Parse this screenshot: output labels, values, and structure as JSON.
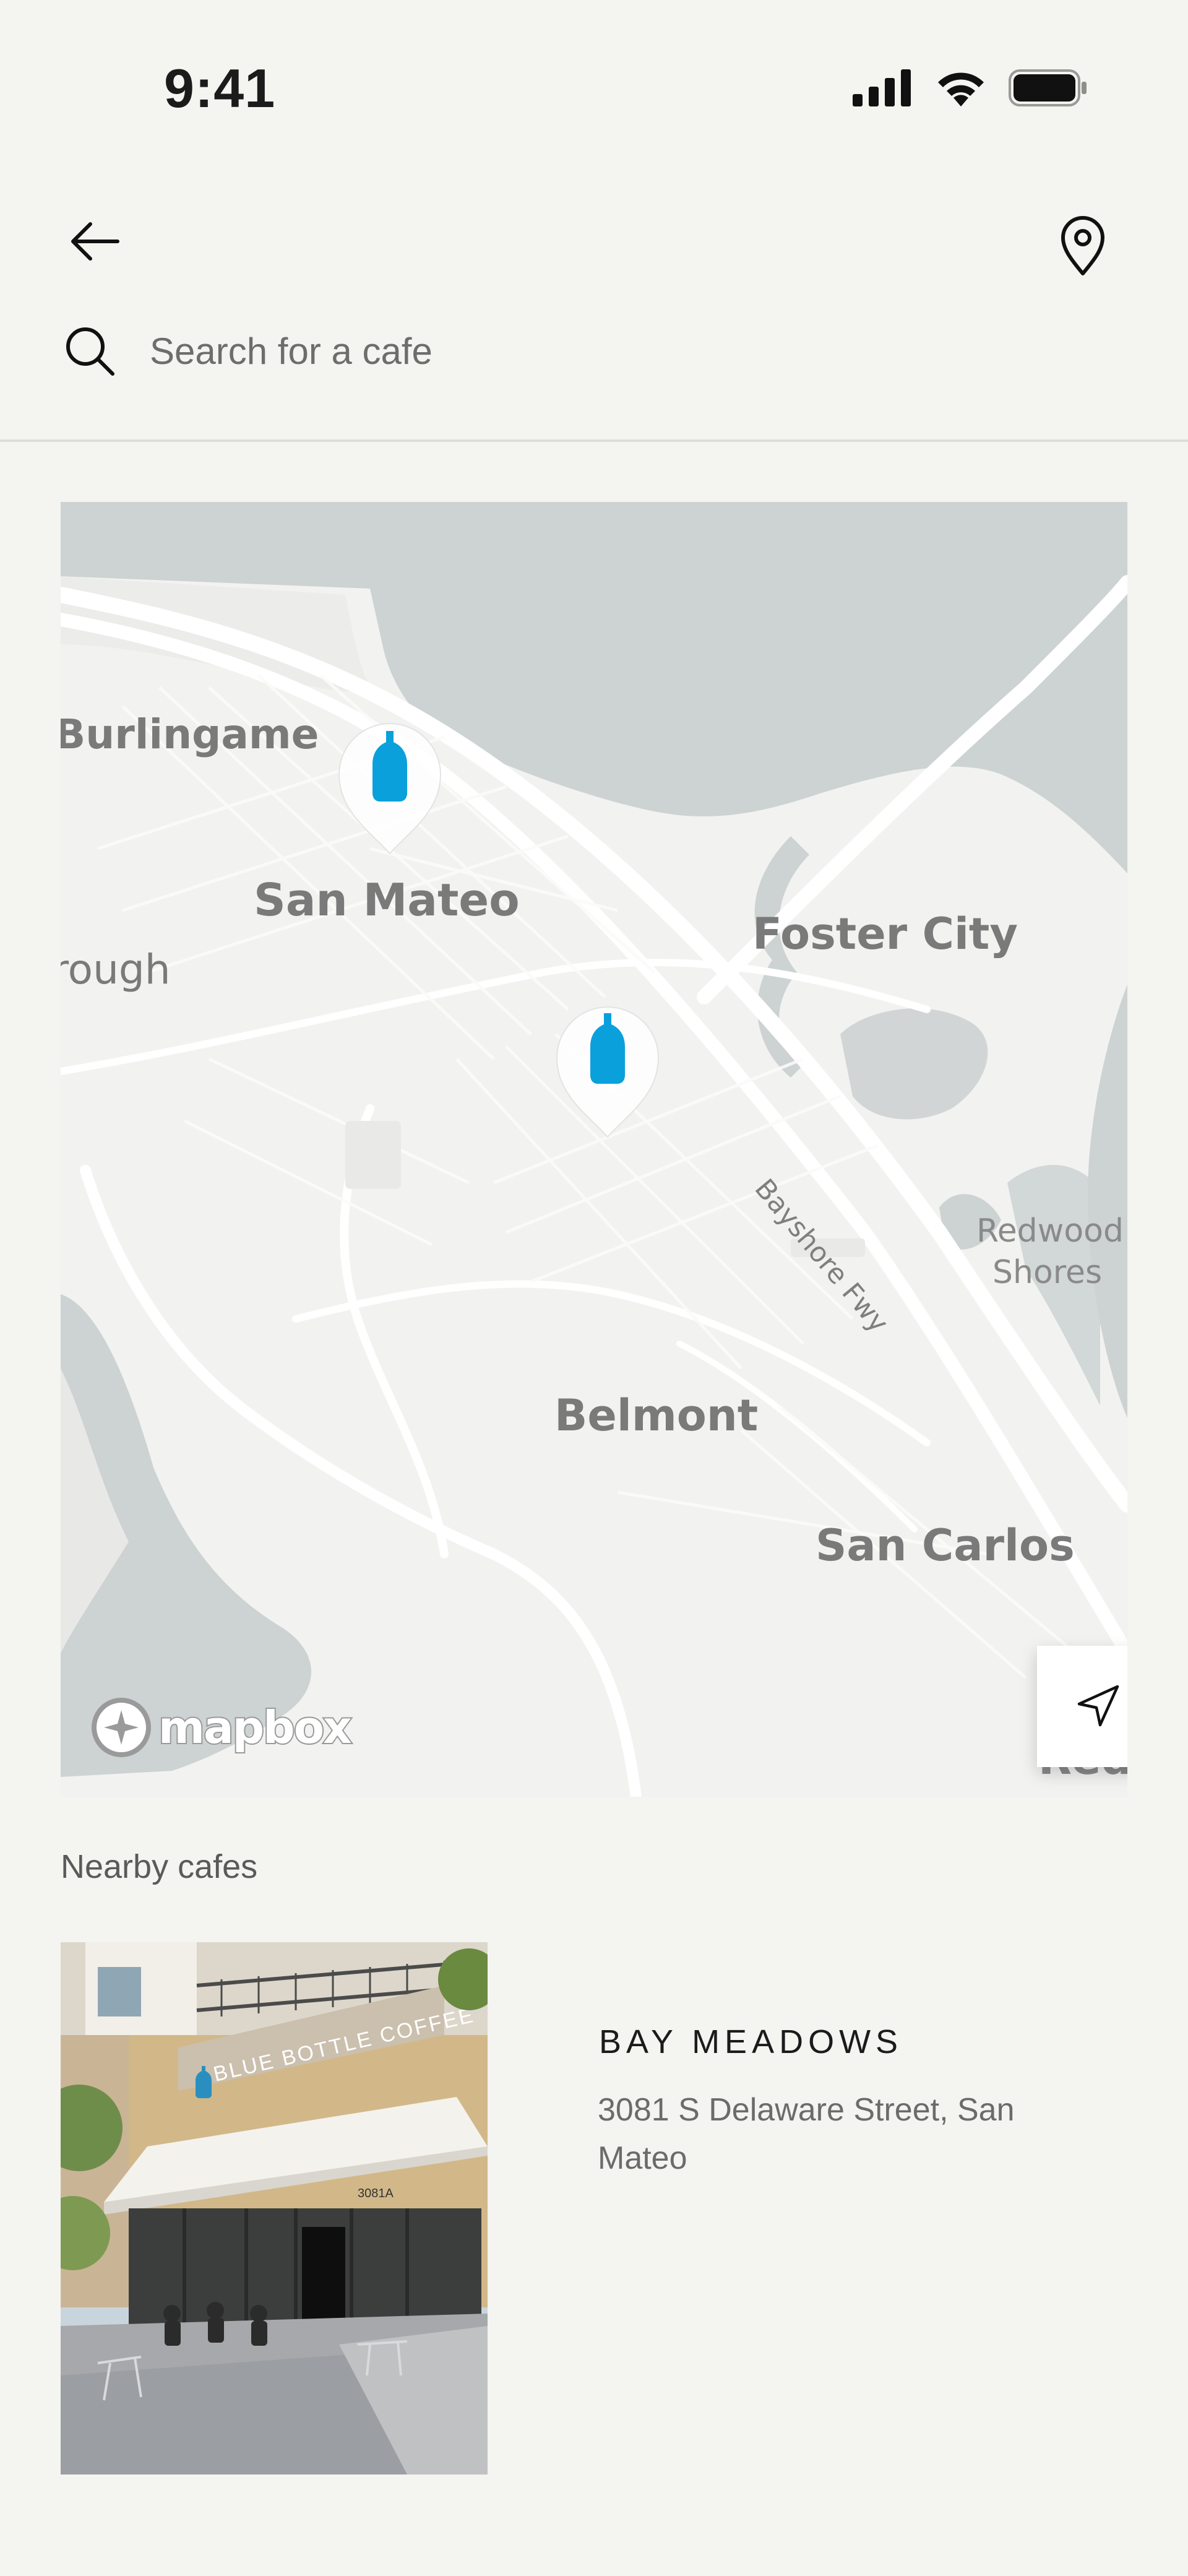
{
  "status_bar": {
    "time": "9:41"
  },
  "search": {
    "placeholder": "Search for a cafe"
  },
  "map": {
    "places": {
      "burlingame": "Burlingame",
      "san_mateo": "San Mateo",
      "foster_city": "Foster City",
      "rough": "rough",
      "bayshore": "Bayshore Fwy",
      "redwood_shores_1": "Redwood",
      "redwood_shores_2": "Shores",
      "belmont": "Belmont",
      "san_carlos": "San Carlos",
      "redw": "Redw"
    },
    "attribution": "mapbox"
  },
  "nearby": {
    "label": "Nearby cafes",
    "cafes": [
      {
        "name": "BAY MEADOWS",
        "address": "3081 S Delaware Street, San Mateo",
        "sign": "BLUE BOTTLE COFFEE",
        "number": "3081A"
      }
    ]
  },
  "colors": {
    "accent": "#0aa0db",
    "water": "#cdd2d2",
    "background": "#f4f4f0"
  }
}
